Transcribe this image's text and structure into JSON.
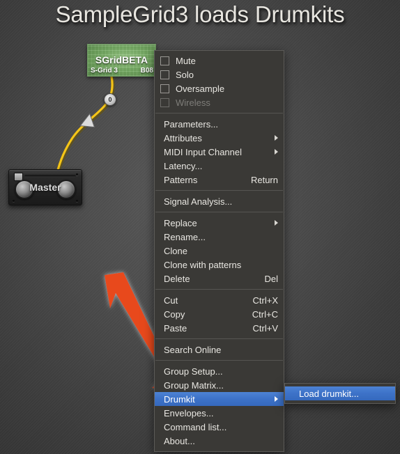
{
  "title": "SampleGrid3 loads Drumkits",
  "colors": {
    "menu_background": "#3a3936",
    "menu_border": "#5c5b58",
    "menu_text": "#e9e7e2",
    "menu_disabled_text": "#7e7d79",
    "highlight_blue": "#3d72c8",
    "arrow_red": "#e8491c",
    "module_green": "#7bb268",
    "cable_yellow": "#f5c518"
  },
  "patch": {
    "sgrid_module": {
      "title": "SGridBETA",
      "sub_left": "S-Grid 3",
      "sub_right": "B08"
    },
    "master_module": {
      "label": "Master"
    },
    "cable_badge": "0"
  },
  "context_menu": {
    "items": [
      {
        "id": "mute",
        "label": "Mute",
        "type": "checkbox",
        "checked": false,
        "disabled": false,
        "accel": "",
        "submenu": false
      },
      {
        "id": "solo",
        "label": "Solo",
        "type": "checkbox",
        "checked": false,
        "disabled": false,
        "accel": "",
        "submenu": false
      },
      {
        "id": "oversample",
        "label": "Oversample",
        "type": "checkbox",
        "checked": false,
        "disabled": false,
        "accel": "",
        "submenu": false
      },
      {
        "id": "wireless",
        "label": "Wireless",
        "type": "checkbox",
        "checked": false,
        "disabled": true,
        "accel": "",
        "submenu": false
      },
      {
        "id": "sep1",
        "type": "separator"
      },
      {
        "id": "parameters",
        "label": "Parameters...",
        "type": "item",
        "accel": "",
        "submenu": false
      },
      {
        "id": "attributes",
        "label": "Attributes",
        "type": "item",
        "accel": "",
        "submenu": true
      },
      {
        "id": "midi-input",
        "label": "MIDI Input Channel",
        "type": "item",
        "accel": "",
        "submenu": true
      },
      {
        "id": "latency",
        "label": "Latency...",
        "type": "item",
        "accel": "",
        "submenu": false
      },
      {
        "id": "patterns",
        "label": "Patterns",
        "type": "item",
        "accel": "Return",
        "submenu": false
      },
      {
        "id": "sep2",
        "type": "separator"
      },
      {
        "id": "signal",
        "label": "Signal Analysis...",
        "type": "item",
        "accel": "",
        "submenu": false
      },
      {
        "id": "sep3",
        "type": "separator"
      },
      {
        "id": "replace",
        "label": "Replace",
        "type": "item",
        "accel": "",
        "submenu": true
      },
      {
        "id": "rename",
        "label": "Rename...",
        "type": "item",
        "accel": "",
        "submenu": false
      },
      {
        "id": "clone",
        "label": "Clone",
        "type": "item",
        "accel": "",
        "submenu": false
      },
      {
        "id": "clone-pat",
        "label": "Clone with patterns",
        "type": "item",
        "accel": "",
        "submenu": false
      },
      {
        "id": "delete",
        "label": "Delete",
        "type": "item",
        "accel": "Del",
        "submenu": false
      },
      {
        "id": "sep4",
        "type": "separator"
      },
      {
        "id": "cut",
        "label": "Cut",
        "type": "item",
        "accel": "Ctrl+X",
        "submenu": false
      },
      {
        "id": "copy",
        "label": "Copy",
        "type": "item",
        "accel": "Ctrl+C",
        "submenu": false
      },
      {
        "id": "paste",
        "label": "Paste",
        "type": "item",
        "accel": "Ctrl+V",
        "submenu": false
      },
      {
        "id": "sep5",
        "type": "separator"
      },
      {
        "id": "search",
        "label": "Search Online",
        "type": "item",
        "accel": "",
        "submenu": false
      },
      {
        "id": "sep6",
        "type": "separator"
      },
      {
        "id": "group-setup",
        "label": "Group Setup...",
        "type": "item",
        "accel": "",
        "submenu": false
      },
      {
        "id": "group-matrix",
        "label": "Group Matrix...",
        "type": "item",
        "accel": "",
        "submenu": false
      },
      {
        "id": "drumkit",
        "label": "Drumkit",
        "type": "item",
        "accel": "",
        "submenu": true,
        "selected": true
      },
      {
        "id": "envelopes",
        "label": "Envelopes...",
        "type": "item",
        "accel": "",
        "submenu": false
      },
      {
        "id": "command-list",
        "label": "Command list...",
        "type": "item",
        "accel": "",
        "submenu": false
      },
      {
        "id": "about",
        "label": "About...",
        "type": "item",
        "accel": "",
        "submenu": false
      }
    ]
  },
  "submenu": {
    "items": [
      {
        "id": "load-drumkit",
        "label": "Load drumkit...",
        "type": "item",
        "accel": "",
        "submenu": false,
        "selected": true
      }
    ]
  }
}
